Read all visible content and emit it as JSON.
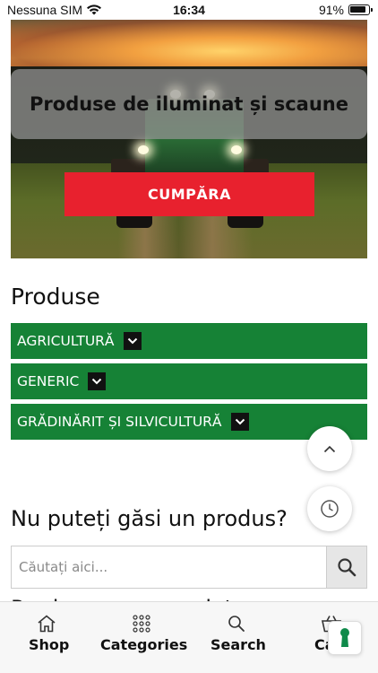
{
  "status_bar": {
    "carrier": "Nessuna SIM",
    "time": "16:34",
    "battery": "91%"
  },
  "hero": {
    "title": "Produse de iluminat și scaune",
    "button_label": "CUMPĂRA"
  },
  "products": {
    "title": "Produse",
    "categories": [
      {
        "label": "AGRICULTURĂ"
      },
      {
        "label": "GENERIC"
      },
      {
        "label": "GRĂDINĂRIT ȘI SILVICULTURĂ"
      }
    ]
  },
  "search": {
    "title": "Nu puteți găsi un produs?",
    "placeholder": "Căutați aici..."
  },
  "next_section": {
    "partial_title": "Produse recomandate"
  },
  "bottom_nav": {
    "items": [
      {
        "label": "Shop",
        "icon": "home-icon"
      },
      {
        "label": "Categories",
        "icon": "grid-icon"
      },
      {
        "label": "Search",
        "icon": "search-icon"
      },
      {
        "label": "Cart",
        "icon": "basket-icon"
      }
    ]
  },
  "colors": {
    "category_green": "#168236",
    "cta_red": "#e8212e"
  }
}
